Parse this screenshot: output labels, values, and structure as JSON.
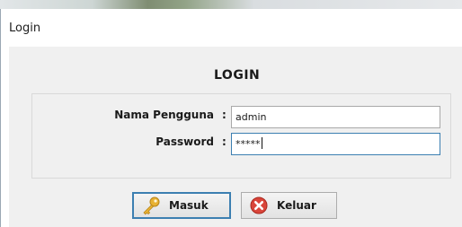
{
  "window": {
    "title": "Login"
  },
  "form": {
    "heading": "LOGIN",
    "username": {
      "label": "Nama Pengguna",
      "value": "admin"
    },
    "password": {
      "label": "Password",
      "value": "*****"
    },
    "colon": ":"
  },
  "buttons": {
    "masuk": {
      "label": "Masuk",
      "icon": "key-icon"
    },
    "keluar": {
      "label": "Keluar",
      "icon": "close-circle-icon"
    }
  },
  "colors": {
    "focus_border": "#3c7fb1",
    "close_red": "#d9453a",
    "key_gold": "#e8b233"
  }
}
